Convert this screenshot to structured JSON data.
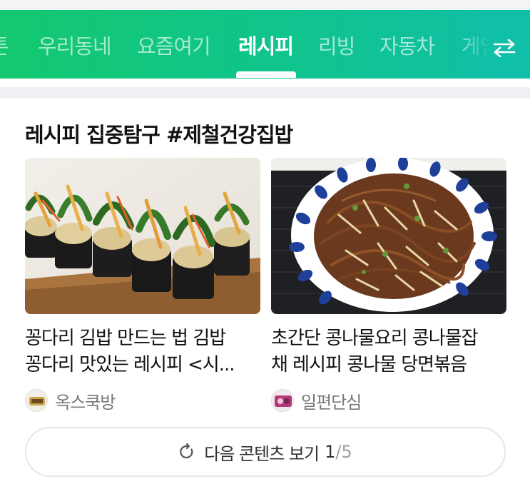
{
  "nav": {
    "tabs": [
      {
        "label": "튼",
        "active": false
      },
      {
        "label": "우리동네",
        "active": false
      },
      {
        "label": "요즘여기",
        "active": false
      },
      {
        "label": "레시피",
        "active": true
      },
      {
        "label": "리빙",
        "active": false
      },
      {
        "label": "자동차",
        "active": false
      },
      {
        "label": "게임",
        "active": false
      }
    ],
    "swap_icon": "swap-arrows-icon",
    "accent_color": "#13c88a"
  },
  "section": {
    "title": "레시피 집중탐구 #제철건강집밥"
  },
  "cards": [
    {
      "title_line1": "꽁다리 김밥 만드는 법 김밥",
      "title_line2": "꽁다리 맛있는 레시피 <시...",
      "source": "옥스쿡방",
      "image": "kimbap-rolls-photo"
    },
    {
      "title_line1": "초간단 콩나물요리 콩나물잡",
      "title_line2": "채 레시피 콩나물 당면볶음",
      "source": "일편단심",
      "image": "japchae-bowl-photo"
    }
  ],
  "more": {
    "label": "다음 콘텐츠 보기",
    "current_page": "1",
    "separator": "/",
    "total_pages": "5",
    "icon": "refresh-icon"
  }
}
